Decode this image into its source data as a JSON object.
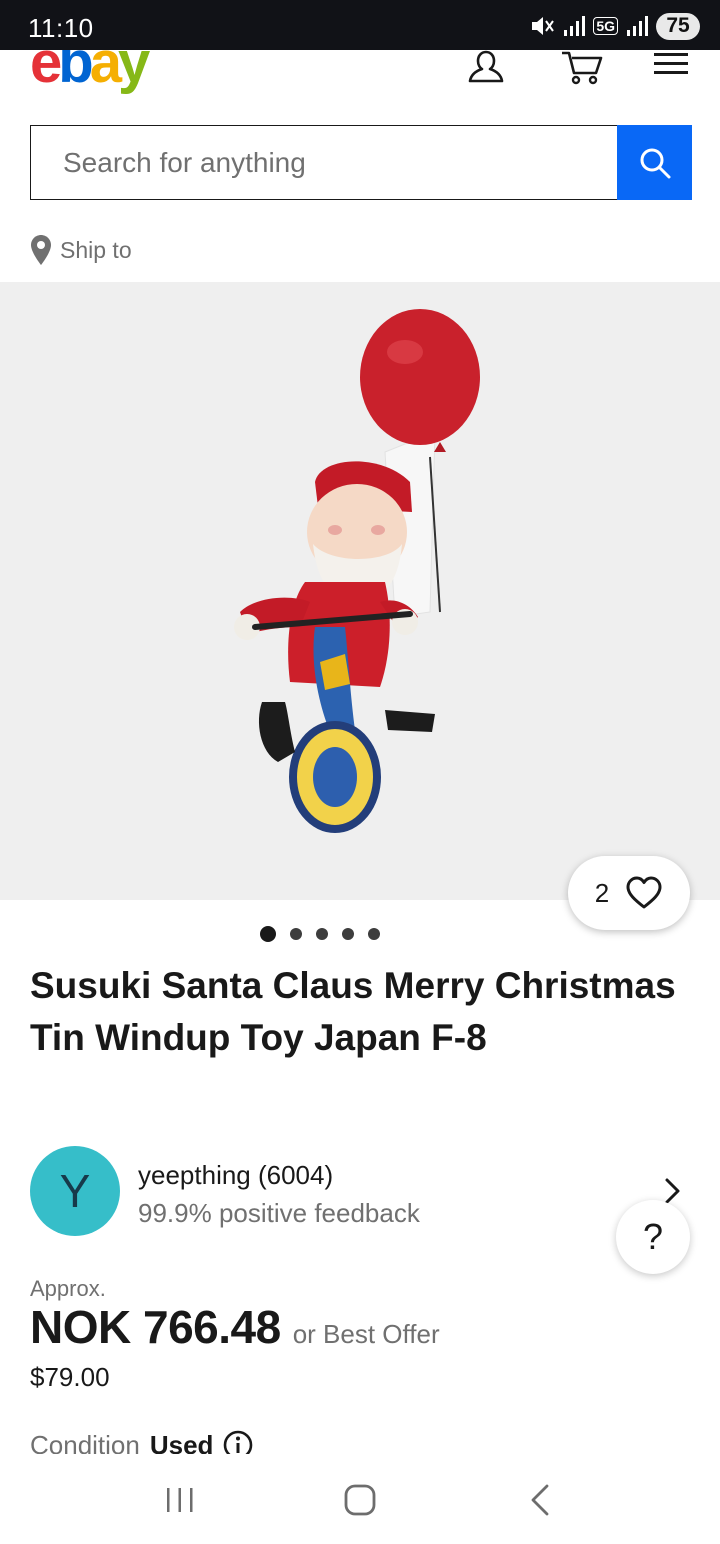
{
  "status_bar": {
    "time": "11:10",
    "battery": "75",
    "network": "5G"
  },
  "header": {
    "logo": {
      "e": "e",
      "b": "b",
      "a": "a",
      "y": "y"
    },
    "icons": [
      "account-icon",
      "cart-icon",
      "menu-icon"
    ]
  },
  "search": {
    "placeholder": "Search for anything"
  },
  "ship_to": {
    "label": "Ship to"
  },
  "gallery": {
    "watch_count": "2",
    "image_index": 1,
    "image_total": 5
  },
  "listing": {
    "title": "Susuki Santa Claus Merry Christmas Tin Windup Toy Japan F-8"
  },
  "seller": {
    "avatar_letter": "Y",
    "name": "yeepthing (6004)",
    "feedback": "99.9% positive feedback"
  },
  "price": {
    "approx_label": "Approx.",
    "amount": "NOK 766.48",
    "best_offer": "or Best Offer",
    "original": "$79.00"
  },
  "condition": {
    "label": "Condition",
    "value": "Used"
  },
  "help": {
    "label": "?"
  },
  "colors": {
    "search_button": "#0968f6",
    "avatar_bg": "#36bec9",
    "logo_red": "#e53238",
    "logo_blue": "#0064d2",
    "logo_yellow": "#f5af02",
    "logo_green": "#86b817"
  }
}
